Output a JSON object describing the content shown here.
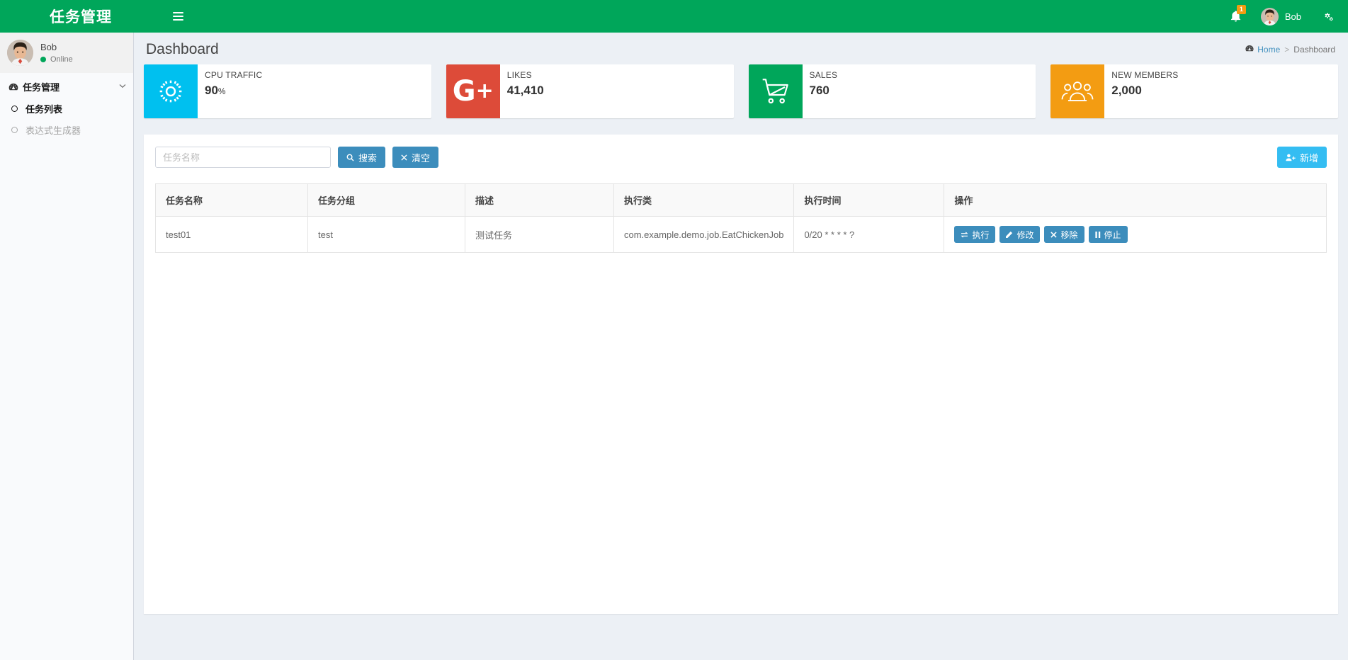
{
  "header": {
    "logo_text": "任务管理",
    "toggle_icon": "hamburger-icon",
    "notification_count": "1",
    "username": "Bob",
    "settings_icon": "gears-icon"
  },
  "sidebar": {
    "user": {
      "name": "Bob",
      "status": "Online"
    },
    "menu": [
      {
        "label": "任务管理",
        "icon": "dashboard-icon",
        "arrow": "chevron-down-icon",
        "children": [
          {
            "label": "任务列表",
            "icon": "circle-o-icon",
            "active": true
          },
          {
            "label": "表达式生成器",
            "icon": "circle-o-icon",
            "active": false
          }
        ]
      }
    ]
  },
  "content": {
    "page_title": "Dashboard",
    "breadcrumb": {
      "icon": "dashboard-icon",
      "home": "Home",
      "separator": ">",
      "current": "Dashboard"
    },
    "info_boxes": [
      {
        "icon": "gear-icon",
        "color": "#00c0ef",
        "text": "CPU TRAFFIC",
        "number": "90",
        "unit": "%"
      },
      {
        "icon": "google-plus-icon",
        "color": "#dd4b39",
        "text": "LIKES",
        "number": "41,410",
        "unit": ""
      },
      {
        "icon": "shopping-cart-icon",
        "color": "#00a65a",
        "text": "SALES",
        "number": "760",
        "unit": ""
      },
      {
        "icon": "users-icon",
        "color": "#f39c12",
        "text": "NEW MEMBERS",
        "number": "2,000",
        "unit": ""
      }
    ],
    "toolbar": {
      "search_placeholder": "任务名称",
      "search_value": "",
      "search_button": "搜索",
      "search_button_icon": "search-icon",
      "clear_button": "清空",
      "clear_button_icon": "times-icon",
      "add_button": "新增",
      "add_button_icon": "user-plus-icon"
    },
    "table": {
      "columns": [
        "任务名称",
        "任务分组",
        "描述",
        "执行类",
        "执行时间",
        "操作"
      ],
      "rows": [
        {
          "name": "test01",
          "group": "test",
          "description": "测试任务",
          "job_class": "com.example.demo.job.EatChickenJob",
          "cron": "0/20 * * * * ?",
          "actions": [
            {
              "label": "执行",
              "icon": "exchange-icon"
            },
            {
              "label": "修改",
              "icon": "pencil-icon"
            },
            {
              "label": "移除",
              "icon": "times-icon"
            },
            {
              "label": "停止",
              "icon": "pause-icon"
            }
          ]
        }
      ]
    }
  },
  "colors": {
    "brand_green": "#00a65a",
    "primary_blue": "#3c8dbc",
    "info_blue": "#34bdf2",
    "warning_orange": "#f39c12",
    "danger_red": "#dd4b39",
    "aqua": "#00c0ef",
    "content_bg": "#ecf0f5"
  }
}
